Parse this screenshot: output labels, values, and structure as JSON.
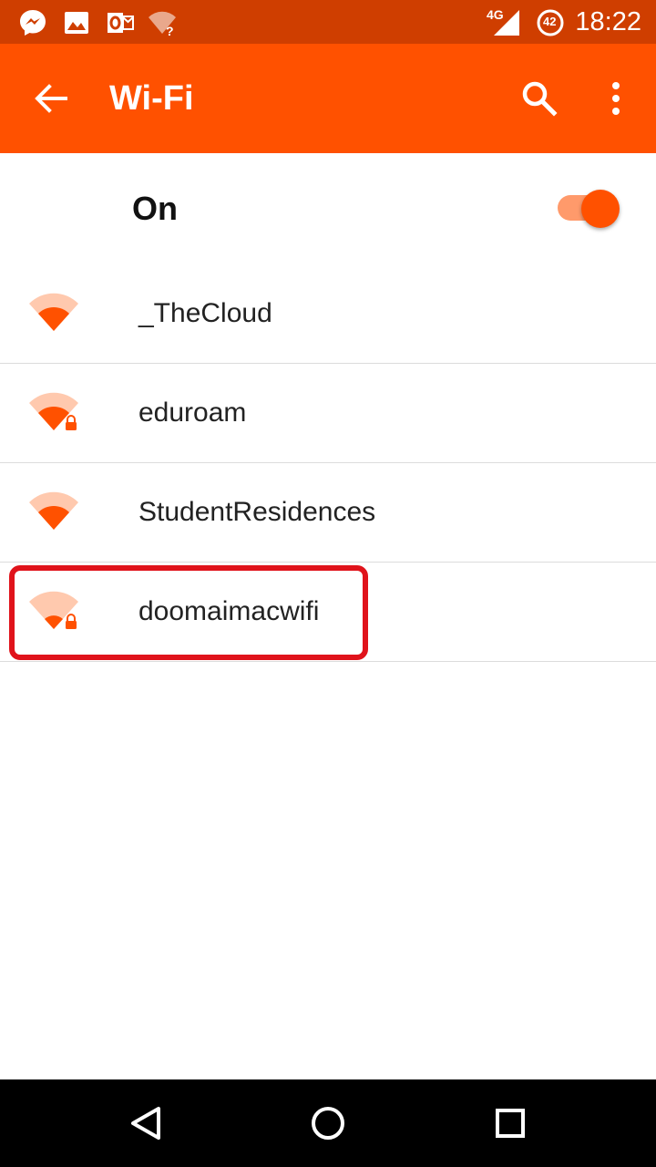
{
  "status_bar": {
    "time": "18:22",
    "network_type": "4G",
    "battery_level": "42",
    "notification_icons": [
      "messenger-icon",
      "gallery-icon",
      "outlook-icon",
      "wifi-unknown-icon"
    ],
    "colors": {
      "background": "#cf3e00"
    }
  },
  "app_bar": {
    "title": "Wi-Fi",
    "icons": [
      "back-arrow-icon",
      "search-icon",
      "more-vert-icon"
    ],
    "colors": {
      "background": "#ff5100"
    }
  },
  "wifi_switch": {
    "label": "On",
    "enabled": true
  },
  "networks": [
    {
      "ssid": "_TheCloud",
      "secured": false,
      "signal": "medium"
    },
    {
      "ssid": "eduroam",
      "secured": true,
      "signal": "medium"
    },
    {
      "ssid": "StudentResidences",
      "secured": false,
      "signal": "medium"
    },
    {
      "ssid": "doomaimacwifi",
      "secured": true,
      "signal": "weak"
    }
  ],
  "annotation": {
    "highlighted_network": "doomaimacwifi",
    "color": "#e0131b"
  },
  "nav_bar": {
    "buttons": [
      "back-triangle-icon",
      "home-circle-icon",
      "recents-square-icon"
    ]
  },
  "colors": {
    "accent": "#ff5100",
    "wifi_strong": "#ff5100",
    "wifi_weak": "#ffc9ae"
  }
}
